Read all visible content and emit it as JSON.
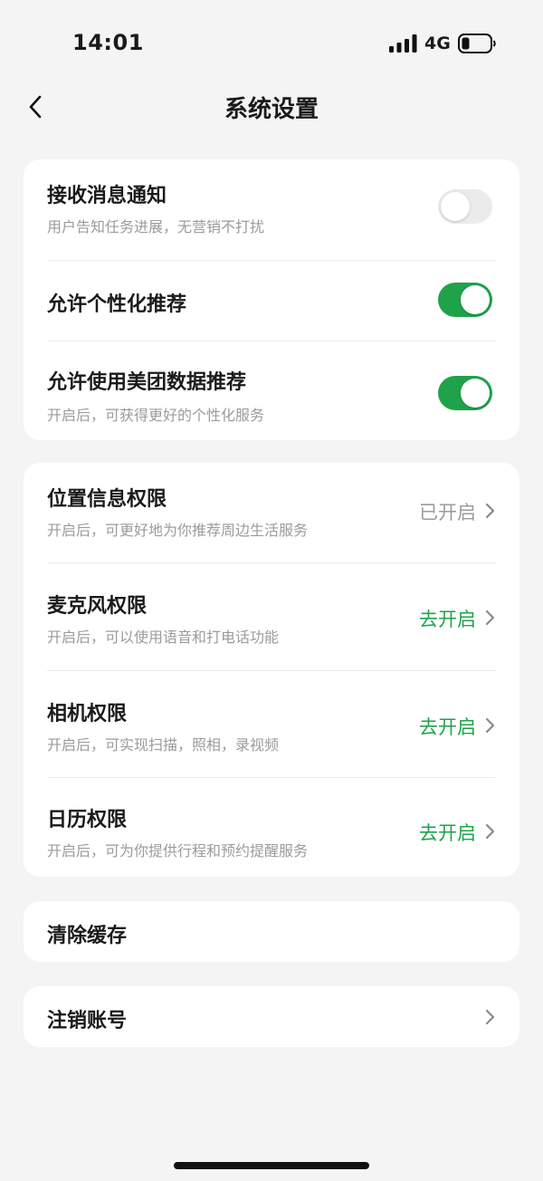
{
  "status_bar": {
    "time": "14:01",
    "network": "4G"
  },
  "nav": {
    "title": "系统设置",
    "back_icon": "chevron-left-icon"
  },
  "notifications_card": {
    "receive_notifications": {
      "title": "接收消息通知",
      "subtitle": "用户告知任务进展，无营销不打扰",
      "enabled": false
    },
    "personalized_recommendation": {
      "title": "允许个性化推荐",
      "enabled": true
    },
    "meituan_data_recommendation": {
      "title": "允许使用美团数据推荐",
      "subtitle": "开启后，可获得更好的个性化服务",
      "enabled": true
    }
  },
  "permissions_card": {
    "items": [
      {
        "title": "位置信息权限",
        "subtitle": "开启后，可更好地为你推荐周边生活服务",
        "status": "已开启",
        "status_color": "#9b9b9b"
      },
      {
        "title": "麦克风权限",
        "subtitle": "开启后，可以使用语音和打电话功能",
        "status": "去开启",
        "status_color": "#1fa34a"
      },
      {
        "title": "相机权限",
        "subtitle": "开启后，可实现扫描，照相，录视频",
        "status": "去开启",
        "status_color": "#1fa34a"
      },
      {
        "title": "日历权限",
        "subtitle": "开启后，可为你提供行程和预约提醒服务",
        "status": "去开启",
        "status_color": "#1fa34a"
      }
    ]
  },
  "clear_cache": {
    "title": "清除缓存"
  },
  "delete_account": {
    "title": "注销账号"
  },
  "colors": {
    "accent": "#1fa34a",
    "background": "#f4f4f4",
    "card": "#ffffff",
    "secondary_text": "#9b9b9b"
  }
}
